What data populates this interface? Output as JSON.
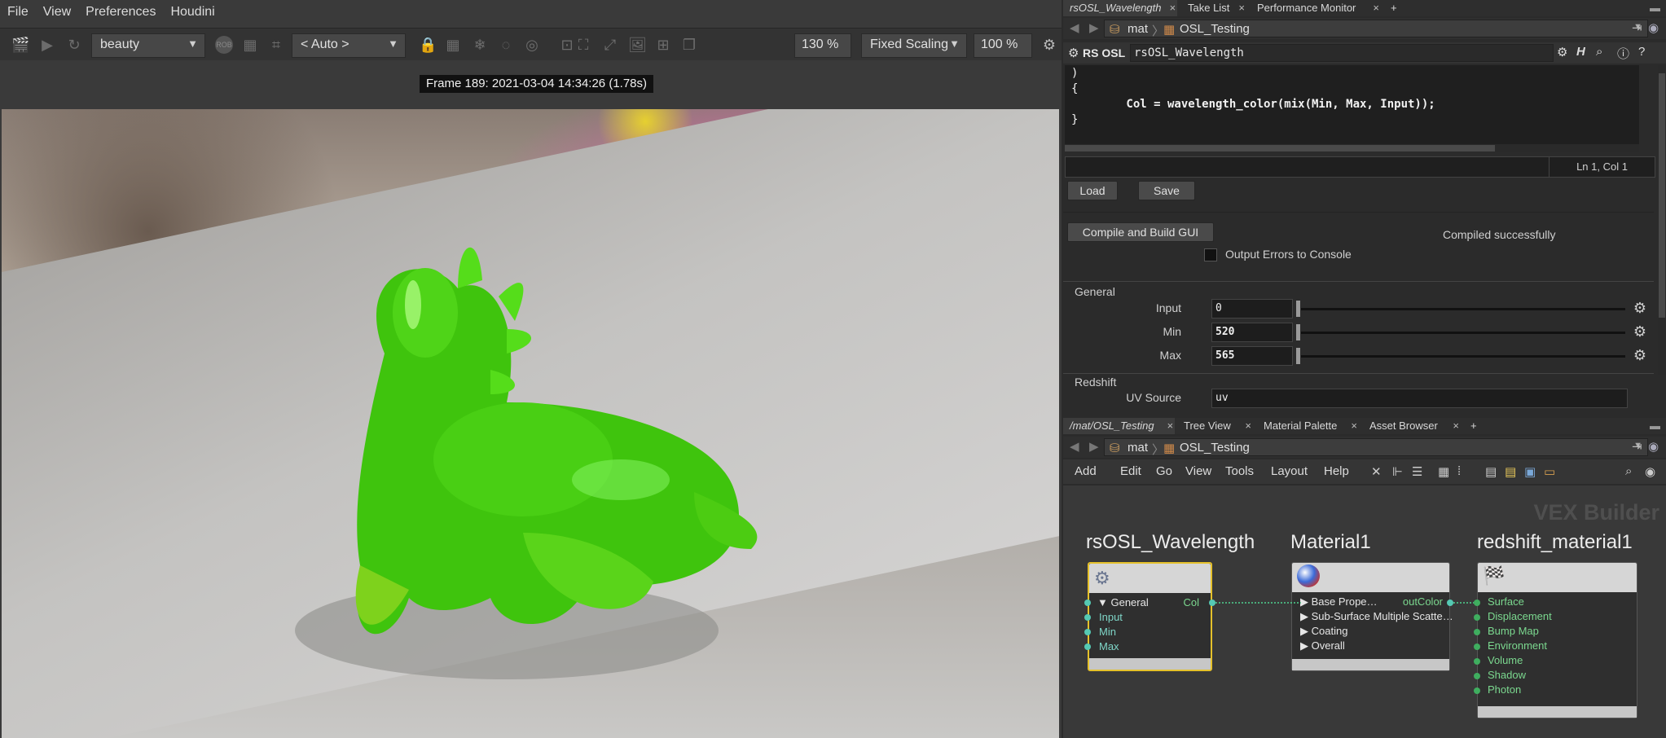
{
  "menubar": {
    "items": [
      "File",
      "View",
      "Preferences",
      "Houdini"
    ]
  },
  "toolbar": {
    "aov": "beauty",
    "camera": "< Auto >",
    "zoom": "130 %",
    "scaling": "Fixed Scaling",
    "zoom2": "100 %",
    "rob_label": "ROB"
  },
  "frame_info": "Frame  189:  2021-03-04  14:34:26  (1.78s)",
  "right": {
    "top_tabs": [
      {
        "label": "rsOSL_Wavelength",
        "active": true
      },
      {
        "label": "Take List"
      },
      {
        "label": "Performance Monitor"
      }
    ],
    "path": {
      "context": "mat",
      "node": "OSL_Testing"
    },
    "param_header": {
      "type": "RS OSL",
      "name": "rsOSL_Wavelength"
    },
    "code_lines": [
      ")",
      "{",
      "        Col = wavelength_color(mix(Min, Max, Input));",
      "}"
    ],
    "cursor_pos": "Ln 1, Col 1",
    "buttons": {
      "load": "Load",
      "save": "Save",
      "compile": "Compile and Build GUI"
    },
    "compile_status": "Compiled successfully",
    "output_errors": "Output Errors to Console",
    "general_label": "General",
    "fields": [
      {
        "label": "Input",
        "value": "0",
        "fill": 0
      },
      {
        "label": "Min",
        "value": "520",
        "fill": 0
      },
      {
        "label": "Max",
        "value": "565",
        "fill": 0
      }
    ],
    "redshift_label": "Redshift",
    "uv_label": "UV Source",
    "uv_value": "uv",
    "bottom_tabs": [
      {
        "label": "/mat/OSL_Testing",
        "active": true
      },
      {
        "label": "Tree View"
      },
      {
        "label": "Material Palette"
      },
      {
        "label": "Asset Browser"
      }
    ],
    "net_menu": [
      "Add",
      "Edit",
      "Go",
      "View",
      "Tools",
      "Layout",
      "Help"
    ],
    "vex_builder": "VEX Builder",
    "nodes": {
      "osl": {
        "title": "rsOSL_Wavelength",
        "inputs": [
          "General",
          "Input",
          "Min",
          "Max"
        ],
        "output": "Col"
      },
      "material": {
        "title": "Material1",
        "inputs": [
          "Base Prope…",
          "Sub-Surface Multiple Scatte…",
          "Coating",
          "Overall"
        ],
        "output": "outColor"
      },
      "redshift": {
        "title": "redshift_material1",
        "inputs": [
          "Surface",
          "Displacement",
          "Bump Map",
          "Environment",
          "Volume",
          "Shadow",
          "Photon"
        ]
      }
    }
  }
}
